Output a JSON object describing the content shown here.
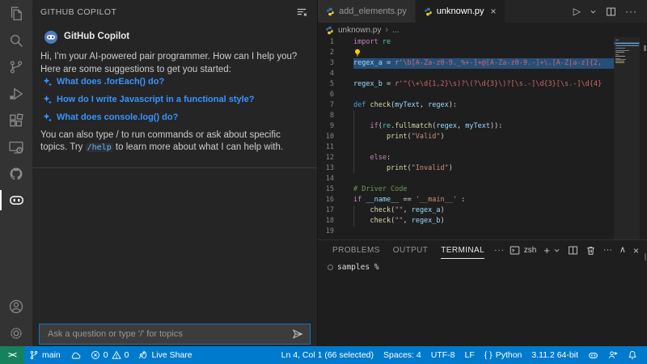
{
  "colors": {
    "accent": "#007acc",
    "remote": "#16825d",
    "selection": "#264f78",
    "link": "#3794ff",
    "editor_bg": "#1e1e1e",
    "sidebar_bg": "#252526",
    "activity_bg": "#333333"
  },
  "glyphs": {
    "more": "···",
    "run": "▷",
    "chev_up": "∧",
    "close": "×",
    "plus": "+",
    "remote": "><",
    "braces": "{ }",
    "crumb_sep": "›"
  },
  "activity_bar": {
    "items": [
      {
        "name": "explorer",
        "active": false
      },
      {
        "name": "search",
        "active": false
      },
      {
        "name": "source-control",
        "active": false
      },
      {
        "name": "run-debug",
        "active": false
      },
      {
        "name": "extensions",
        "active": false
      },
      {
        "name": "remote-explorer",
        "active": false
      },
      {
        "name": "github",
        "active": false
      },
      {
        "name": "copilot-chat",
        "active": true
      }
    ],
    "bottom": [
      {
        "name": "account",
        "active": false
      },
      {
        "name": "settings",
        "active": false
      }
    ]
  },
  "sidebar": {
    "title": "GITHUB COPILOT",
    "chat": {
      "author": "GitHub Copilot",
      "greeting": "Hi, I'm your AI-powered pair programmer. How can I help you?",
      "suggestions_intro": "Here are some suggestions to get you started:",
      "suggestions": [
        "What does .forEach() do?",
        "How do I write Javascript in a functional style?",
        "What does console.log() do?"
      ],
      "footer_pre": "You can also type / to run commands or ask about specific topics. Try ",
      "footer_code": "/help",
      "footer_post": " to learn more about what I can help with."
    },
    "input": {
      "placeholder": "Ask a question or type '/' for topics"
    }
  },
  "editor": {
    "tabs": [
      {
        "label": "add_elements.py",
        "icon": "python",
        "active": false,
        "closable": false
      },
      {
        "label": "unknown.py",
        "icon": "python",
        "active": true,
        "closable": true
      }
    ],
    "breadcrumb": {
      "file": "unknown.py",
      "rest": "..."
    },
    "code_lines": [
      {
        "n": 1,
        "segs": [
          [
            "kw",
            "import"
          ],
          [
            "pl",
            " "
          ],
          [
            "mod",
            "re"
          ]
        ]
      },
      {
        "n": 2,
        "lightbulb": true,
        "segs": []
      },
      {
        "n": 3,
        "selected": true,
        "segs": [
          [
            "var",
            "regex_a"
          ],
          [
            "pl",
            " = "
          ],
          [
            "str",
            "r'"
          ],
          [
            "rex",
            "\\b[A-Za-z0-9._%+-]+@[A-Za-z0-9.-]+\\.[A-Z|a-z]{2,"
          ]
        ]
      },
      {
        "n": 4,
        "segs": []
      },
      {
        "n": 5,
        "segs": [
          [
            "var",
            "regex_b"
          ],
          [
            "pl",
            " = "
          ],
          [
            "str",
            "r'"
          ],
          [
            "rex",
            "^(\\+\\d{1,2}\\s)?\\(?\\d{3}\\)?[\\s.-]\\d{3}[\\s.-]\\d{4}"
          ]
        ]
      },
      {
        "n": 6,
        "segs": []
      },
      {
        "n": 7,
        "segs": [
          [
            "kwb",
            "def"
          ],
          [
            "pl",
            " "
          ],
          [
            "fn",
            "check"
          ],
          [
            "pl",
            "("
          ],
          [
            "var",
            "myText"
          ],
          [
            "pl",
            ", "
          ],
          [
            "var",
            "regex"
          ],
          [
            "pl",
            "):"
          ]
        ]
      },
      {
        "n": 8,
        "segs": []
      },
      {
        "n": 9,
        "segs": [
          [
            "pl",
            "    "
          ],
          [
            "kw",
            "if"
          ],
          [
            "pl",
            "("
          ],
          [
            "mod",
            "re"
          ],
          [
            "pl",
            "."
          ],
          [
            "fn",
            "fullmatch"
          ],
          [
            "pl",
            "("
          ],
          [
            "var",
            "regex"
          ],
          [
            "pl",
            ", "
          ],
          [
            "var",
            "myText"
          ],
          [
            "pl",
            ")):"
          ]
        ]
      },
      {
        "n": 10,
        "segs": [
          [
            "pl",
            "        "
          ],
          [
            "fn",
            "print"
          ],
          [
            "pl",
            "("
          ],
          [
            "str",
            "\"Valid\""
          ],
          [
            "pl",
            ")"
          ]
        ]
      },
      {
        "n": 11,
        "segs": []
      },
      {
        "n": 12,
        "segs": [
          [
            "pl",
            "    "
          ],
          [
            "kw",
            "else"
          ],
          [
            "pl",
            ":"
          ]
        ]
      },
      {
        "n": 13,
        "segs": [
          [
            "pl",
            "        "
          ],
          [
            "fn",
            "print"
          ],
          [
            "pl",
            "("
          ],
          [
            "str",
            "\"Invalid\""
          ],
          [
            "pl",
            ")"
          ]
        ]
      },
      {
        "n": 14,
        "segs": []
      },
      {
        "n": 15,
        "segs": [
          [
            "cmt",
            "# Driver Code"
          ]
        ]
      },
      {
        "n": 16,
        "segs": [
          [
            "kw",
            "if"
          ],
          [
            "pl",
            " "
          ],
          [
            "var",
            "__name__"
          ],
          [
            "pl",
            " == "
          ],
          [
            "str",
            "'__main__'"
          ],
          [
            "pl",
            " :"
          ]
        ]
      },
      {
        "n": 17,
        "segs": [
          [
            "pl",
            "    "
          ],
          [
            "fn",
            "check"
          ],
          [
            "pl",
            "("
          ],
          [
            "str",
            "\"\""
          ],
          [
            "pl",
            ", "
          ],
          [
            "var",
            "regex_a"
          ],
          [
            "pl",
            ")"
          ]
        ]
      },
      {
        "n": 18,
        "segs": [
          [
            "pl",
            "    "
          ],
          [
            "fn",
            "check"
          ],
          [
            "pl",
            "("
          ],
          [
            "str",
            "\"\""
          ],
          [
            "pl",
            ", "
          ],
          [
            "var",
            "regex_b"
          ],
          [
            "pl",
            ")"
          ]
        ]
      },
      {
        "n": 19,
        "segs": []
      }
    ]
  },
  "panel": {
    "tabs": [
      {
        "label": "PROBLEMS",
        "active": false
      },
      {
        "label": "OUTPUT",
        "active": false
      },
      {
        "label": "TERMINAL",
        "active": true
      }
    ],
    "shell_label": "zsh",
    "prompt": "samples %"
  },
  "status_bar": {
    "left": [
      {
        "name": "git-branch",
        "icon": "git-branch",
        "label": "main"
      },
      {
        "name": "sync-cloud",
        "icon": "cloud",
        "label": ""
      },
      {
        "name": "problems",
        "parts": [
          {
            "icon": "error",
            "label": "0"
          },
          {
            "icon": "warning",
            "label": "0"
          }
        ]
      },
      {
        "name": "live-share",
        "icon": "live-share",
        "label": "Live Share"
      }
    ],
    "right": [
      {
        "name": "cursor-position",
        "label": "Ln 4, Col 1 (66 selected)"
      },
      {
        "name": "indentation",
        "label": "Spaces: 4"
      },
      {
        "name": "encoding",
        "label": "UTF-8"
      },
      {
        "name": "eol",
        "label": "LF"
      },
      {
        "name": "language-mode",
        "glyph": "braces",
        "label": "Python"
      },
      {
        "name": "python-interpreter",
        "label": "3.11.2 64-bit"
      },
      {
        "name": "copilot-status",
        "icon": "copilot-small",
        "label": ""
      },
      {
        "name": "feedback",
        "icon": "feedback",
        "label": ""
      },
      {
        "name": "notifications",
        "icon": "bell",
        "label": ""
      }
    ]
  }
}
